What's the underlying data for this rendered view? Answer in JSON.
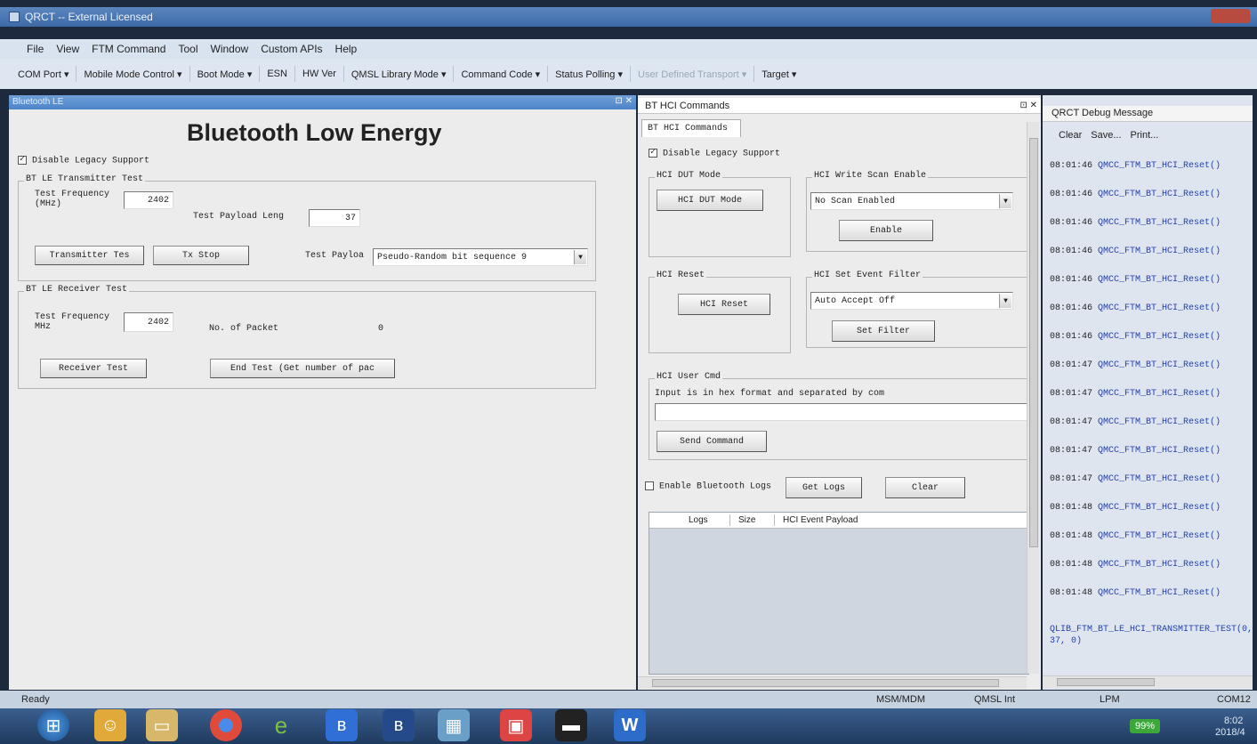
{
  "window": {
    "title": "QRCT -- External Licensed"
  },
  "menu": [
    "File",
    "View",
    "FTM Command",
    "Tool",
    "Window",
    "Custom APIs",
    "Help"
  ],
  "toolbar": [
    "COM Port ▾",
    "Mobile Mode Control ▾",
    "Boot Mode ▾",
    "ESN",
    "HW Ver",
    "QMSL Library Mode ▾",
    "Command Code ▾",
    "Status Polling ▾",
    "User Defined Transport ▾",
    "Target ▾"
  ],
  "ble": {
    "tab_title": "Bluetooth LE",
    "heading": "Bluetooth Low Energy",
    "disable_legacy": "Disable Legacy Support",
    "tx": {
      "group": "BT LE Transmitter Test",
      "freq_label": "Test Frequency (MHz)",
      "freq_value": "2402",
      "payload_len_label": "Test Payload Leng",
      "payload_len_value": "37",
      "tx_button": "Transmitter Tes",
      "stop_button": "Tx Stop",
      "payload_label": "Test Payloa",
      "payload_value": "Pseudo-Random bit sequence 9"
    },
    "rx": {
      "group": "BT LE Receiver Test",
      "freq_label": "Test Frequency MHz",
      "freq_value": "2402",
      "packets_label": "No. of Packet",
      "packets_value": "0",
      "rx_button": "Receiver Test",
      "end_button": "End Test (Get number of pac"
    }
  },
  "hci": {
    "panel_title": "BT HCI Commands",
    "tab": "BT HCI Commands",
    "disable_legacy": "Disable Legacy Support",
    "dut": {
      "group": "HCI DUT Mode",
      "button": "HCI DUT Mode"
    },
    "scan": {
      "group": "HCI Write Scan Enable",
      "value": "No Scan Enabled",
      "button": "Enable"
    },
    "reset": {
      "group": "HCI Reset",
      "button": "HCI Reset"
    },
    "filter": {
      "group": "HCI Set Event Filter",
      "value": "Auto Accept Off",
      "button": "Set Filter"
    },
    "user_cmd": {
      "group": "HCI User Cmd",
      "hint": "Input is in hex format and separated by com",
      "button": "Send Command"
    },
    "logs": {
      "enable": "Enable Bluetooth Logs",
      "get": "Get Logs",
      "clear": "Clear",
      "columns": [
        "Logs",
        "Size",
        "HCI Event Payload"
      ]
    }
  },
  "debug": {
    "title": "QRCT Debug Message",
    "buttons": [
      "Clear",
      "Save...",
      "Print..."
    ],
    "rows": [
      {
        "time": "08:01:46",
        "fn": "QMCC_FTM_BT_HCI_Reset()"
      },
      {
        "time": "08:01:46",
        "fn": "QMCC_FTM_BT_HCI_Reset()"
      },
      {
        "time": "08:01:46",
        "fn": "QMCC_FTM_BT_HCI_Reset()"
      },
      {
        "time": "08:01:46",
        "fn": "QMCC_FTM_BT_HCI_Reset()"
      },
      {
        "time": "08:01:46",
        "fn": "QMCC_FTM_BT_HCI_Reset()"
      },
      {
        "time": "08:01:46",
        "fn": "QMCC_FTM_BT_HCI_Reset()"
      },
      {
        "time": "08:01:46",
        "fn": "QMCC_FTM_BT_HCI_Reset()"
      },
      {
        "time": "08:01:47",
        "fn": "QMCC_FTM_BT_HCI_Reset()"
      },
      {
        "time": "08:01:47",
        "fn": "QMCC_FTM_BT_HCI_Reset()"
      },
      {
        "time": "08:01:47",
        "fn": "QMCC_FTM_BT_HCI_Reset()"
      },
      {
        "time": "08:01:47",
        "fn": "QMCC_FTM_BT_HCI_Reset()"
      },
      {
        "time": "08:01:47",
        "fn": "QMCC_FTM_BT_HCI_Reset()"
      },
      {
        "time": "08:01:48",
        "fn": "QMCC_FTM_BT_HCI_Reset()"
      },
      {
        "time": "08:01:48",
        "fn": "QMCC_FTM_BT_HCI_Reset()"
      },
      {
        "time": "08:01:48",
        "fn": "QMCC_FTM_BT_HCI_Reset()"
      },
      {
        "time": "08:01:48",
        "fn": "QMCC_FTM_BT_HCI_Reset()"
      }
    ],
    "last_line": "QLIB_FTM_BT_LE_HCI_TRANSMITTER_TEST(0, 37, 0)"
  },
  "status": {
    "ready": "Ready",
    "msm": "MSM/MDM",
    "qmsl": "QMSL Int",
    "lpm": "LPM",
    "com": "COM12"
  },
  "taskbar": {
    "battery": "99%",
    "time": "8:02",
    "date": "2018/4"
  }
}
